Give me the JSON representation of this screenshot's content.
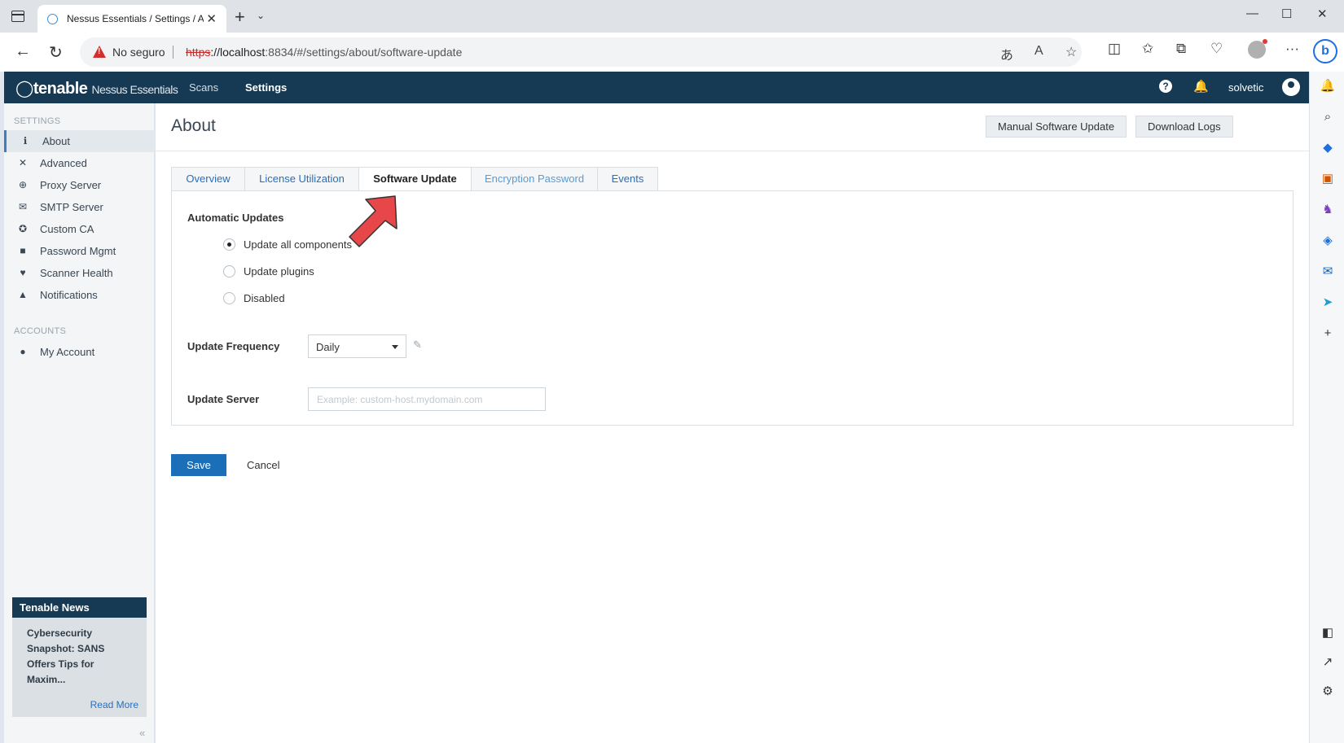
{
  "browser": {
    "tab_title": "Nessus Essentials / Settings / About / Software Update",
    "new_tab_icon": "+",
    "window_controls": [
      "minimize-icon",
      "maximize-icon",
      "close-icon"
    ],
    "security_label": "No seguro",
    "url_scheme": "https",
    "url_host": "://localhost",
    "url_rest": ":8834/#/settings/about/software-update"
  },
  "app": {
    "brand": "tenable",
    "product": "Nessus Essentials",
    "nav": [
      "Scans",
      "Settings"
    ],
    "active_nav": "Settings",
    "username": "solvetic"
  },
  "sidebar": {
    "settings_heading": "SETTINGS",
    "items": [
      {
        "label": "About",
        "icon": "info-icon",
        "active": true
      },
      {
        "label": "Advanced",
        "icon": "tools-icon"
      },
      {
        "label": "Proxy Server",
        "icon": "globe-icon"
      },
      {
        "label": "SMTP Server",
        "icon": "envelope-icon"
      },
      {
        "label": "Custom CA",
        "icon": "ribbon-icon"
      },
      {
        "label": "Password Mgmt",
        "icon": "lock-icon"
      },
      {
        "label": "Scanner Health",
        "icon": "heartbeat-icon"
      },
      {
        "label": "Notifications",
        "icon": "bell-icon"
      }
    ],
    "accounts_heading": "ACCOUNTS",
    "account_items": [
      {
        "label": "My Account",
        "icon": "user-icon"
      }
    ],
    "news": {
      "heading": "Tenable News",
      "headline": "Cybersecurity Snapshot: SANS Offers Tips for Maxim...",
      "read_more": "Read More"
    }
  },
  "main": {
    "title": "About",
    "buttons": {
      "manual_update": "Manual Software Update",
      "download_logs": "Download Logs"
    },
    "tabs": [
      "Overview",
      "License Utilization",
      "Software Update",
      "Encryption Password",
      "Events"
    ],
    "active_tab": "Software Update",
    "automatic_updates": {
      "label": "Automatic Updates",
      "options": [
        "Update all components",
        "Update plugins",
        "Disabled"
      ],
      "selected": "Update all components"
    },
    "frequency": {
      "label": "Update Frequency",
      "value": "Daily"
    },
    "server": {
      "label": "Update Server",
      "placeholder": "Example: custom-host.mydomain.com",
      "value": ""
    },
    "save_label": "Save",
    "cancel_label": "Cancel"
  },
  "colors": {
    "header": "#173a54",
    "primary_button": "#1b6fb8",
    "link": "#2a6ebb",
    "annotation_arrow": "#e8474a"
  }
}
